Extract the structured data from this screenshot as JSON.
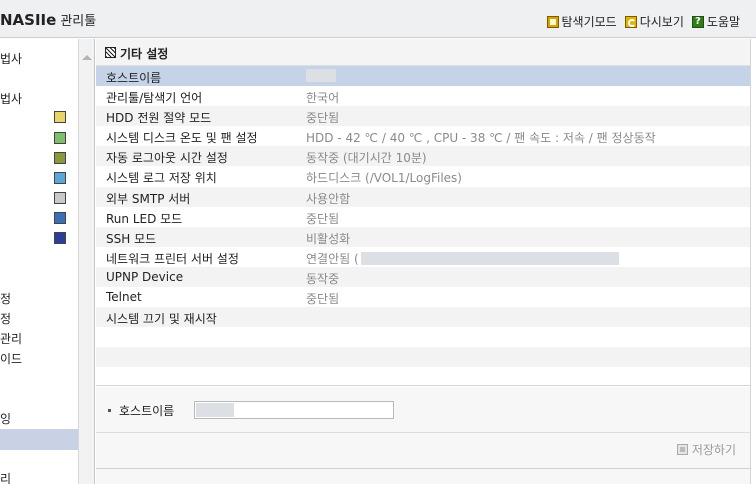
{
  "app": {
    "title": "NASIIe",
    "subtitle": "관리툴"
  },
  "toplinks": [
    {
      "label": "탐색기모드",
      "icon": "folder-mode-icon"
    },
    {
      "label": "다시보기",
      "icon": "refresh-icon"
    },
    {
      "label": "도움말",
      "icon": "help-icon"
    }
  ],
  "sidebar": {
    "items": [
      "법사",
      "법사",
      "정",
      "정",
      "관리",
      "이드",
      "잉",
      "리"
    ],
    "icons": [
      "notebook-icon",
      "grid-icon",
      "table-icon",
      "plug-icon",
      "disk-icon",
      "usb-icon",
      "target-icon"
    ]
  },
  "section": {
    "title": "기타 설정"
  },
  "settings": [
    {
      "label": "호스트이름",
      "value": ""
    },
    {
      "label": "관리툴/탐색기 언어",
      "value": "한국어"
    },
    {
      "label": "HDD 전원 절약 모드",
      "value": "중단됨"
    },
    {
      "label": "시스템 디스크 온도 및 팬 설정",
      "value": "HDD - 42 ℃ / 40 ℃ , CPU - 38 ℃ / 팬 속도 : 저속  / 팬 정상동작"
    },
    {
      "label": "자동 로그아웃 시간 설정",
      "value": "동작중 (대기시간 10분)"
    },
    {
      "label": "시스템 로그 저장 위치",
      "value": "하드디스크 (/VOL1/LogFiles)"
    },
    {
      "label": "외부 SMTP 서버",
      "value": "사용안함"
    },
    {
      "label": "Run LED 모드",
      "value": "중단됨"
    },
    {
      "label": "SSH 모드",
      "value": "비활성화"
    },
    {
      "label": "네트워크 프린터 서버 설정",
      "value": "연결안됨 ("
    },
    {
      "label": "UPNP Device",
      "value": "동작중"
    },
    {
      "label": "Telnet",
      "value": "중단됨"
    },
    {
      "label": "시스템 끄기 및 재시작",
      "value": ""
    }
  ],
  "edit": {
    "label": "호스트이름",
    "value": ""
  },
  "save": {
    "label": "저장하기"
  }
}
